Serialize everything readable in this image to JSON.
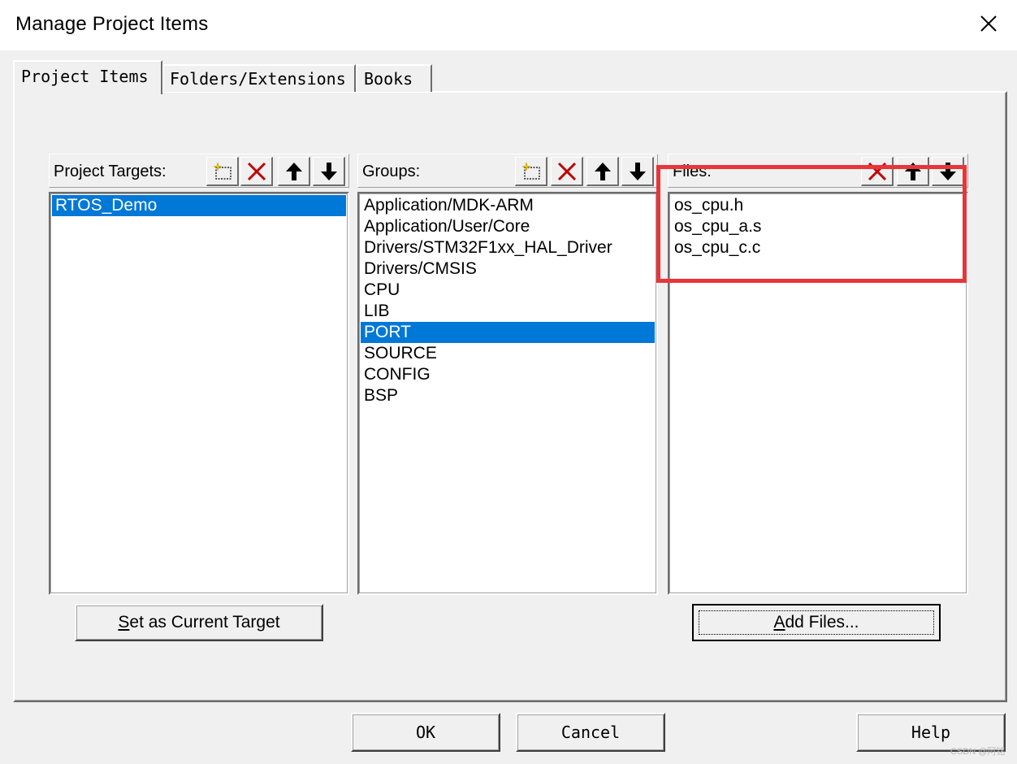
{
  "window": {
    "title": "Manage Project Items",
    "close_icon": "close-icon"
  },
  "tabs": [
    {
      "label": "Project Items",
      "active": true
    },
    {
      "label": "Folders/Extensions",
      "active": false
    },
    {
      "label": "Books",
      "active": false
    }
  ],
  "targets": {
    "header": "Project Targets:",
    "items": [
      "RTOS_Demo"
    ],
    "selected_index": 0,
    "toolbar_icons": [
      "new-item-icon",
      "delete-icon",
      "move-up-icon",
      "move-down-icon"
    ],
    "button_label": "Set as Current Target"
  },
  "groups": {
    "header": "Groups:",
    "items": [
      "Application/MDK-ARM",
      "Application/User/Core",
      "Drivers/STM32F1xx_HAL_Driver",
      "Drivers/CMSIS",
      "CPU",
      "LIB",
      "PORT",
      "SOURCE",
      "CONFIG",
      "BSP"
    ],
    "selected_index": 6,
    "toolbar_icons": [
      "new-item-icon",
      "delete-icon",
      "move-up-icon",
      "move-down-icon"
    ]
  },
  "files": {
    "header": "Files:",
    "items": [
      "os_cpu.h",
      "os_cpu_a.s",
      "os_cpu_c.c"
    ],
    "toolbar_icons": [
      "delete-icon",
      "move-up-icon",
      "move-down-icon"
    ],
    "button_label": "Add Files..."
  },
  "footer": {
    "ok_label": "OK",
    "cancel_label": "Cancel",
    "help_label": "Help"
  },
  "colors": {
    "selection": "#0078d7",
    "highlight_annotation": "#e8353a",
    "delete_icon": "#c00000"
  },
  "watermark": "CSDN @阿铭"
}
